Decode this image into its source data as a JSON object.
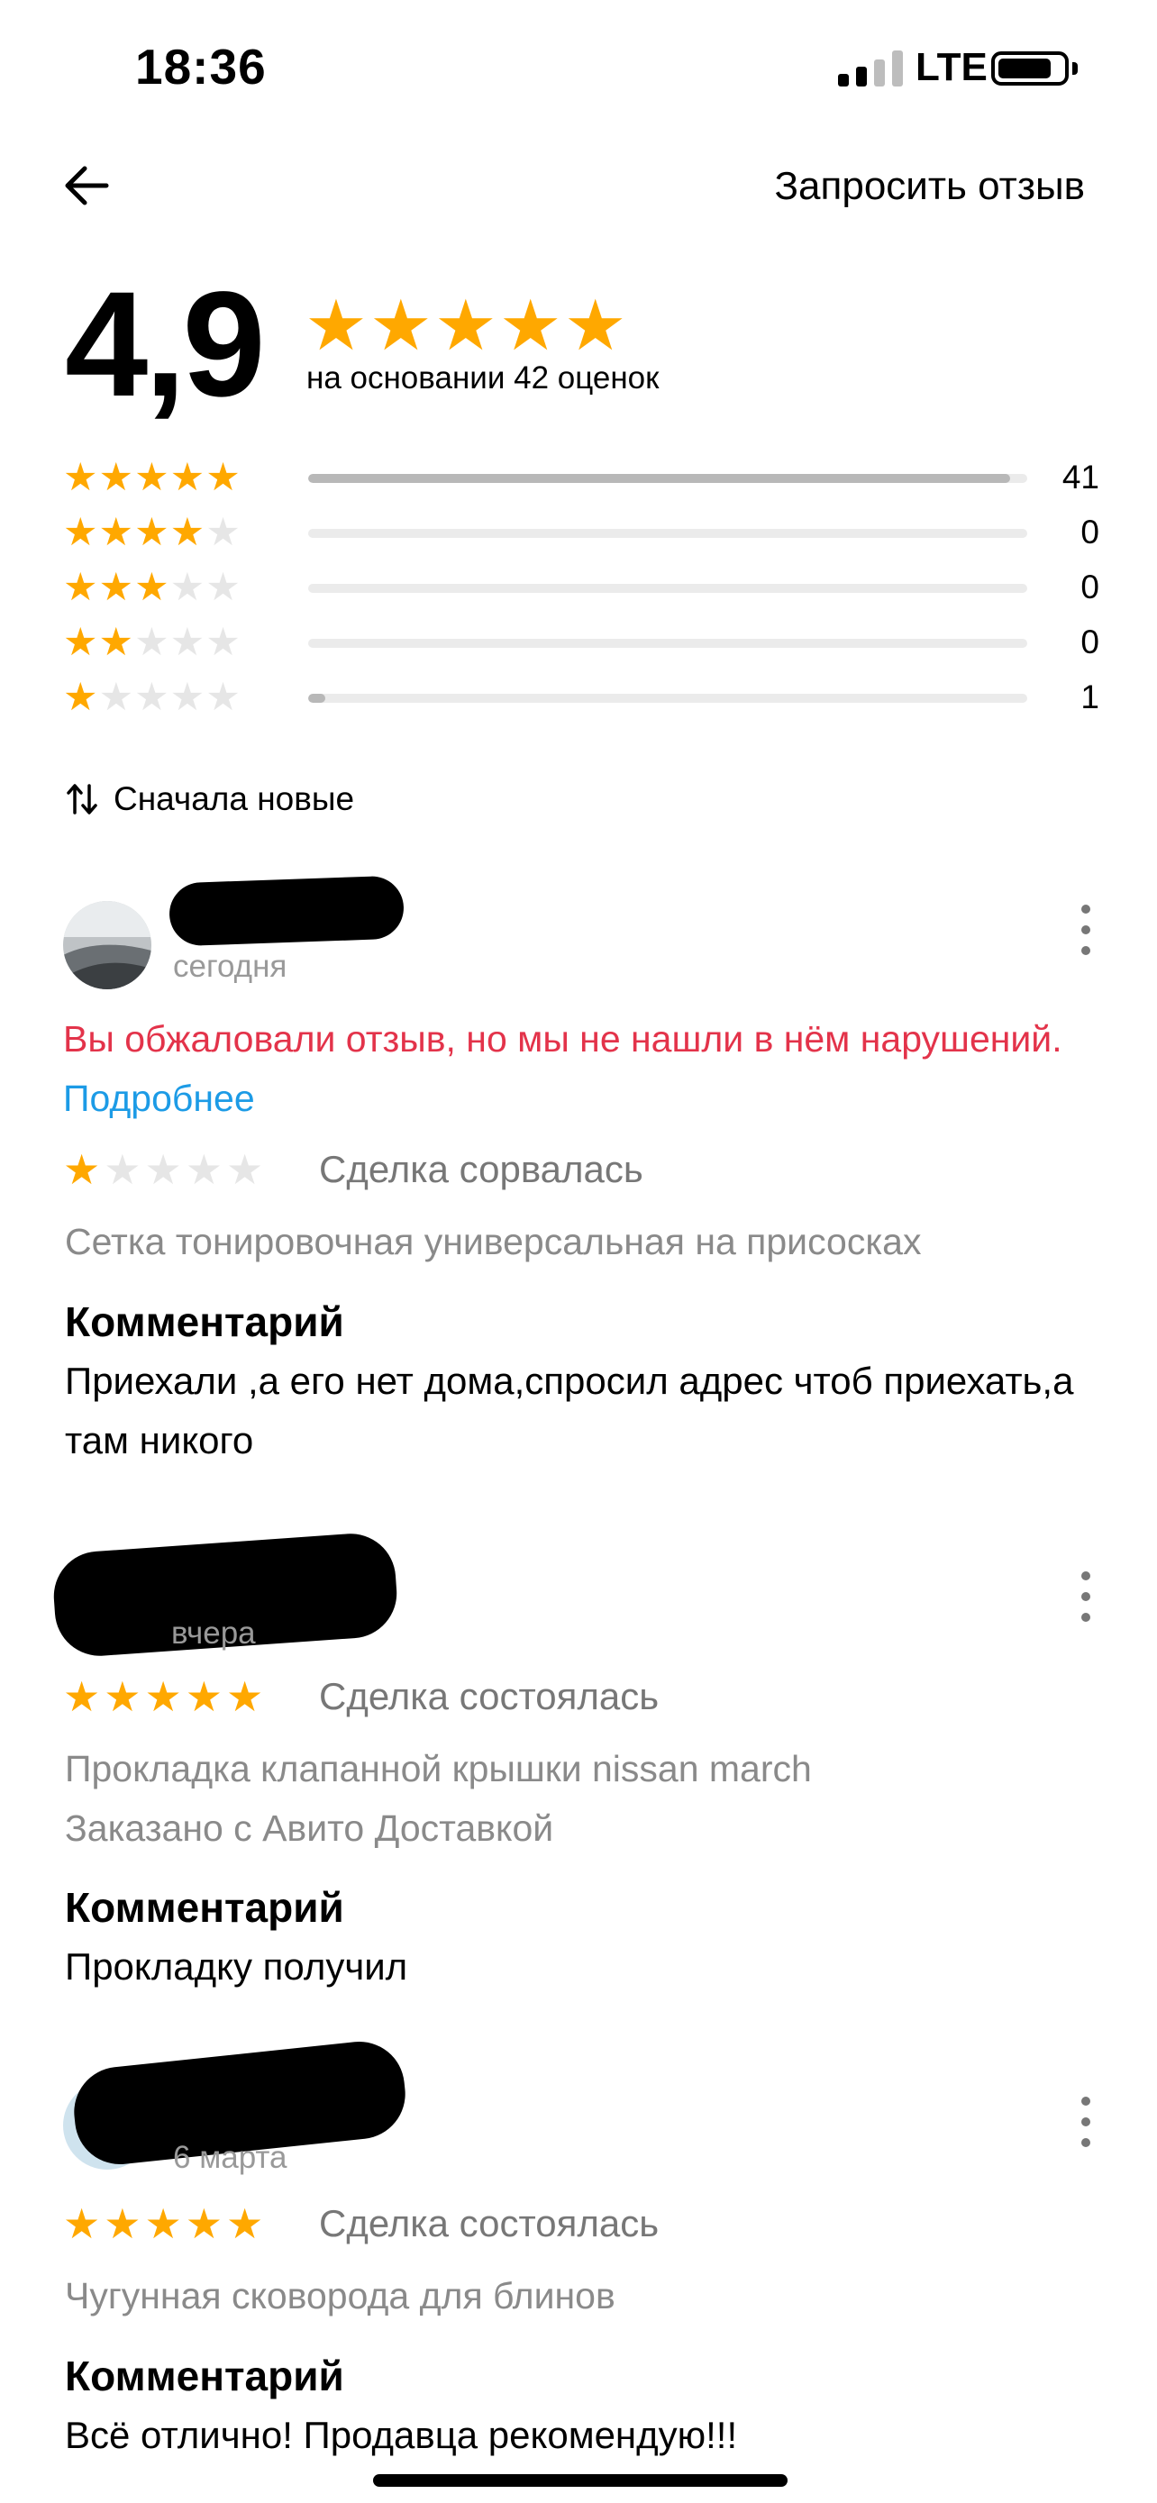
{
  "status_bar": {
    "time": "18:36",
    "network": "LTE"
  },
  "header": {
    "request_review": "Запросить отзыв"
  },
  "summary": {
    "rating": "4,9",
    "based_on": "на основании 42 оценок",
    "distribution": [
      {
        "stars": 5,
        "count": "41",
        "fraction": 0.976
      },
      {
        "stars": 4,
        "count": "0",
        "fraction": 0
      },
      {
        "stars": 3,
        "count": "0",
        "fraction": 0
      },
      {
        "stars": 2,
        "count": "0",
        "fraction": 0
      },
      {
        "stars": 1,
        "count": "1",
        "fraction": 0.024
      }
    ]
  },
  "sort": {
    "label": "Сначала новые"
  },
  "reviews": [
    {
      "date": "сегодня",
      "warning": "Вы обжаловали отзыв, но мы не нашли в нём нарушений.",
      "warning_link": "Подробнее",
      "stars": 1,
      "deal_status": "Сделка сорвалась",
      "item_lines": [
        "Сетка тонировочная универсальная на присосках"
      ],
      "comment_label": "Комментарий",
      "comment": "Приехали ,а его нет дома,спросил адрес чтоб приехать,а там никого"
    },
    {
      "date": "вчера",
      "stars": 5,
      "deal_status": "Сделка состоялась",
      "item_lines": [
        "Прокладка клапанной крышки nissan march",
        "Заказано с Авито Доставкой"
      ],
      "comment_label": "Комментарий",
      "comment": "Прокладку получил"
    },
    {
      "date": "6 марта",
      "stars": 5,
      "deal_status": "Сделка состоялась",
      "item_lines": [
        "Чугунная сковорода для блинов"
      ],
      "comment_label": "Комментарий",
      "comment": "Всё отлично! Продавца рекомендую!!!"
    }
  ],
  "colors": {
    "star": "#ffa800",
    "warning": "#e3334a",
    "link": "#1c9be6"
  }
}
